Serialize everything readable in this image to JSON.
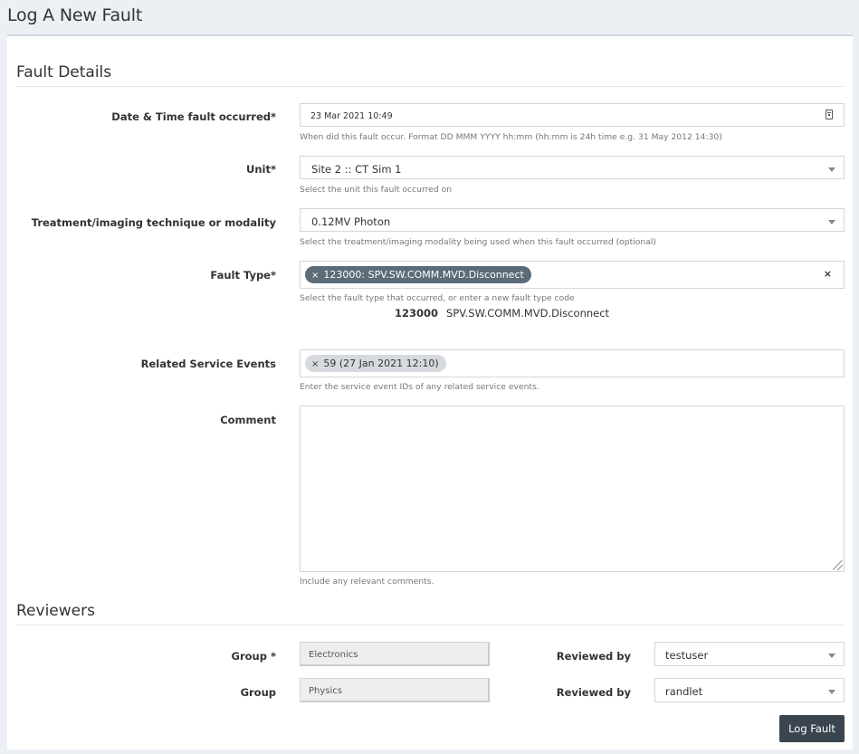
{
  "page": {
    "title": "Log A New Fault"
  },
  "fault_details": {
    "section_title": "Fault Details",
    "date_time": {
      "label": "Date & Time fault occurred*",
      "value": "23 Mar 2021 10:49",
      "help": "When did this fault occur. Format DD MMM YYYY hh:mm (hh:mm is 24h time e.g. 31 May 2012 14:30)"
    },
    "unit": {
      "label": "Unit*",
      "value": "Site 2 :: CT Sim 1",
      "help": "Select the unit this fault occurred on"
    },
    "modality": {
      "label": "Treatment/imaging technique or modality",
      "value": "0.12MV Photon",
      "help": "Select the treatment/imaging modality being used when this fault occurred (optional)"
    },
    "fault_type": {
      "label": "Fault Type*",
      "chip": "123000: SPV.SW.COMM.MVD.Disconnect",
      "chip_remove": "×",
      "clear": "×",
      "help": "Select the fault type that occurred, or enter a new fault type code",
      "code": "123000",
      "name": "SPV.SW.COMM.MVD.Disconnect"
    },
    "related_events": {
      "label": "Related Service Events",
      "chip": "59 (27 Jan 2021 12:10)",
      "chip_remove": "×",
      "help": "Enter the service event IDs of any related service events."
    },
    "comment": {
      "label": "Comment",
      "value": "",
      "help": "Include any relevant comments."
    }
  },
  "reviewers": {
    "section_title": "Reviewers",
    "rows": [
      {
        "group_label": "Group *",
        "group_value": "Electronics",
        "reviewed_label": "Reviewed by",
        "reviewer": "testuser"
      },
      {
        "group_label": "Group",
        "group_value": "Physics",
        "reviewed_label": "Reviewed by",
        "reviewer": "randlet"
      }
    ]
  },
  "actions": {
    "submit_label": "Log Fault"
  }
}
